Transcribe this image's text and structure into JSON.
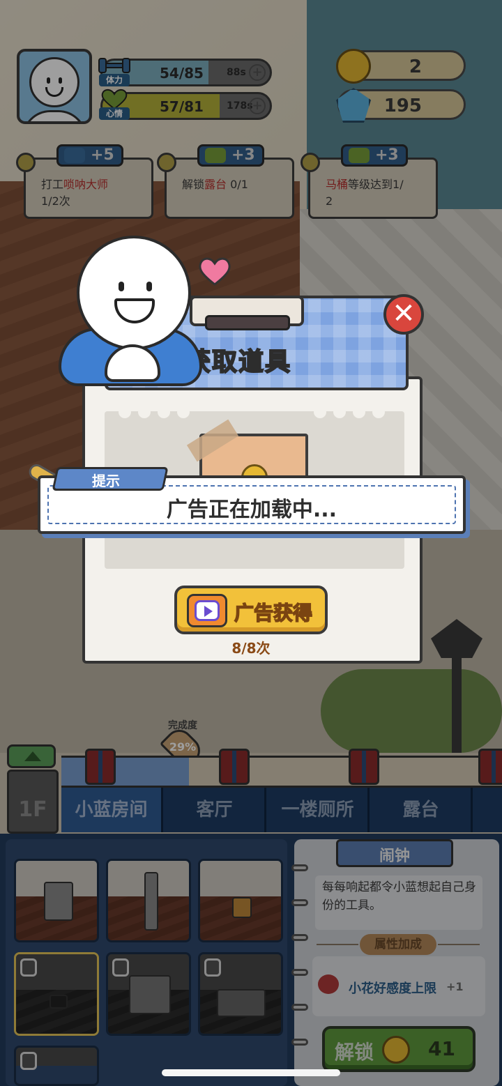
{
  "player": {
    "stamina_value": "54/85",
    "stamina_timer": "88s",
    "stamina_label": "体力",
    "stamina_fraction": 0.635,
    "mood_value": "57/81",
    "mood_timer": "178s",
    "mood_label": "心情",
    "mood_fraction": 0.7
  },
  "currency": {
    "coins": "2",
    "gems": "195"
  },
  "tasks": [
    {
      "reward": "+5",
      "prefix": "打工",
      "highlight": "唢呐大师",
      "suffix": "",
      "line2": "1/2次"
    },
    {
      "reward": "+3",
      "prefix": "解锁",
      "highlight": "露台",
      "suffix": " 0/1",
      "line2": ""
    },
    {
      "reward": "+3",
      "prefix": "",
      "highlight": "马桶",
      "suffix": "等级达到1/",
      "line2": "2"
    }
  ],
  "dialog": {
    "title": "获取道具",
    "close_symbol": "✕",
    "tip_label": "提示",
    "tip_message": "广告正在加载中...",
    "ad_button_label": "广告获得",
    "ad_count": "8/8次"
  },
  "completion": {
    "label": "完成度",
    "percent_text": "29%",
    "fraction": 0.29
  },
  "floor": {
    "label": "1F"
  },
  "rooms": [
    "小蓝房间",
    "客厅",
    "一楼厕所",
    "露台"
  ],
  "active_room": 0,
  "item_info": {
    "name": "闹钟",
    "description": "每每响起都令小蓝想起自己身份的工具。",
    "attr_header": "属性加成",
    "attr_text": "小花好感度上限",
    "attr_value": "+1",
    "unlock_label": "解锁",
    "unlock_price": "41"
  },
  "icons": {
    "stamina": "dumbbell-icon",
    "mood": "heart-icon",
    "coin": "coin-icon",
    "gem": "gem-icon",
    "close": "close-icon",
    "tv": "tv-play-icon",
    "lock": "lock-icon"
  },
  "colors": {
    "stamina_fill": "#7fb0c0",
    "mood_fill": "#b7b43a",
    "dialog_header": "#7ea3e0",
    "ad_button": "#f2c13a",
    "close_button": "#d9463d",
    "unlock_button": "#5f9b3e"
  }
}
